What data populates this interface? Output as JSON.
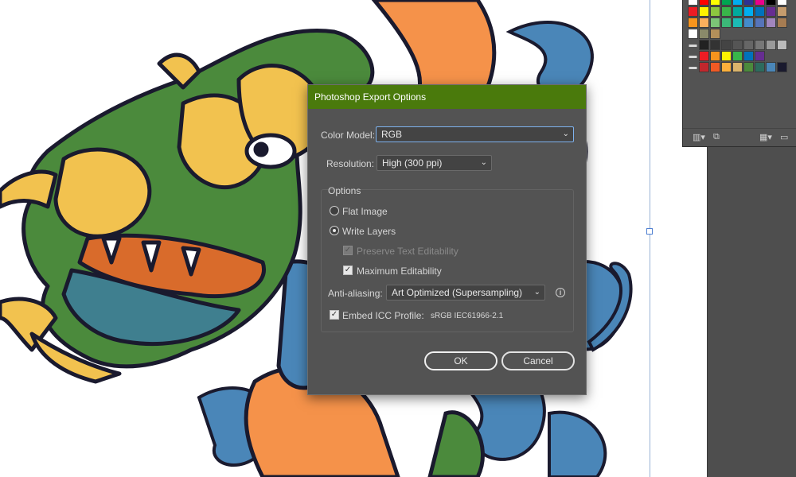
{
  "dialog": {
    "title": "Photoshop Export Options",
    "color_model": {
      "label": "Color Model:",
      "value": "RGB"
    },
    "resolution": {
      "label": "Resolution:",
      "value": "High (300 ppi)"
    },
    "options_group": {
      "legend": "Options",
      "flat_image": {
        "label": "Flat Image",
        "selected": false
      },
      "write_layers": {
        "label": "Write Layers",
        "selected": true
      },
      "preserve_text": {
        "label": "Preserve Text Editability",
        "checked": true,
        "enabled": false
      },
      "max_editability": {
        "label": "Maximum Editability",
        "checked": true
      },
      "anti_aliasing": {
        "label": "Anti-aliasing:",
        "value": "Art Optimized (Supersampling)"
      },
      "embed_icc": {
        "label": "Embed ICC Profile:",
        "checked": true,
        "profile": "sRGB IEC61966-2.1"
      }
    },
    "ok_label": "OK",
    "cancel_label": "Cancel"
  },
  "colors": {
    "title_bar": "#4a7a0c",
    "dialog_bg": "#535353",
    "focus_ring": "#7eb2ee",
    "dragon_green": "#4b8a3c",
    "dragon_yellow": "#f2c24f",
    "dragon_orange": "#f5924a",
    "wave_blue": "#4a86b8",
    "outline": "#1a1a2e"
  },
  "icons": {
    "dropdown": "chevron-down-icon",
    "info": "info-icon",
    "check": "checkmark-icon",
    "folder": "folder-icon"
  }
}
